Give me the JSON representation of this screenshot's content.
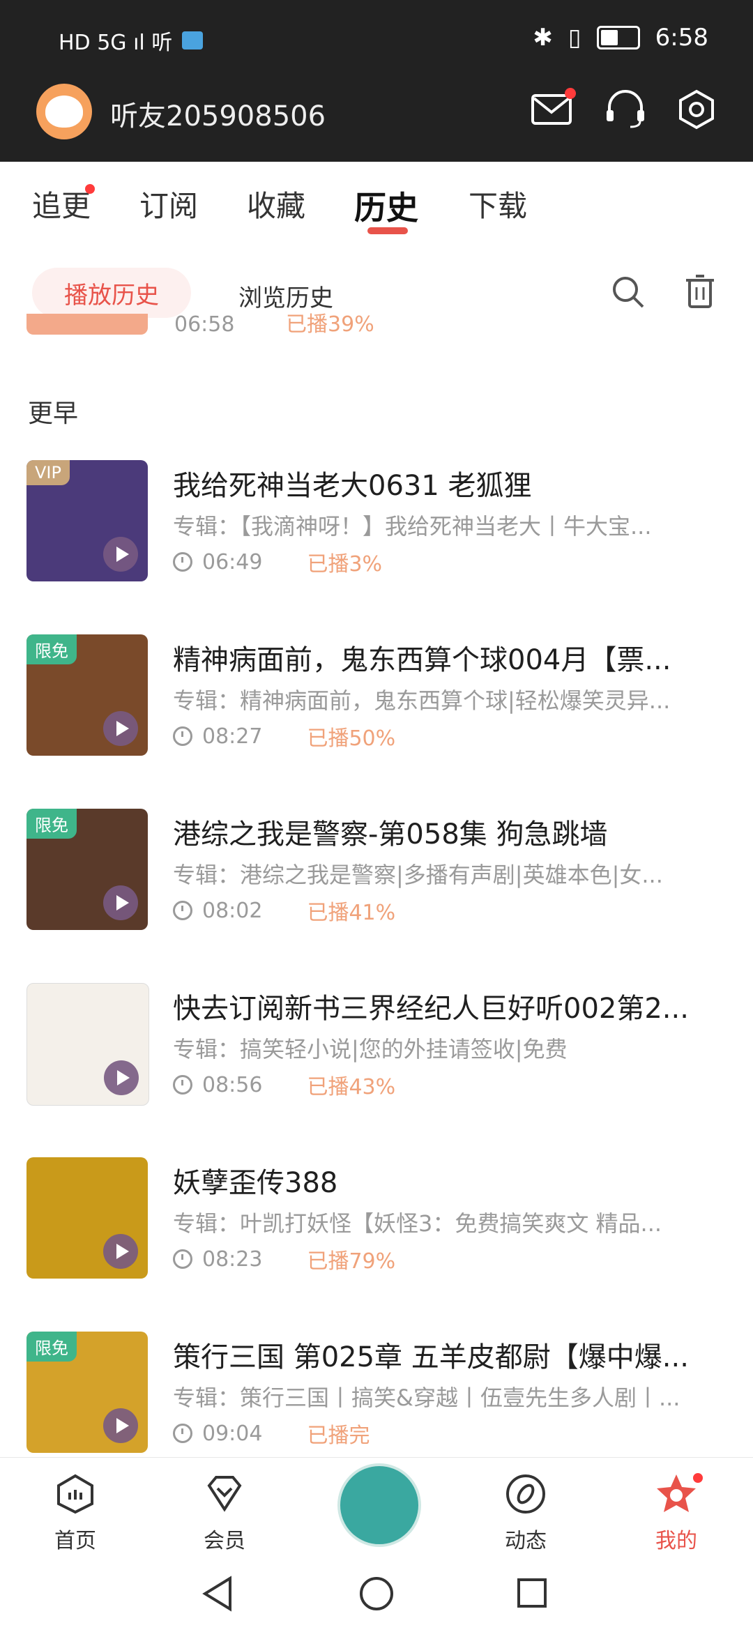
{
  "status_bar": {
    "left_text": "HD 5G ıl 听",
    "time": "6:58",
    "battery_percent": 55
  },
  "profile": {
    "username": "听友205908506"
  },
  "tabs": [
    {
      "label": "追更",
      "has_dot": true
    },
    {
      "label": "订阅"
    },
    {
      "label": "收藏"
    },
    {
      "label": "历史",
      "active": true
    },
    {
      "label": "下载"
    }
  ],
  "subtabs": {
    "active": "播放历史",
    "other": "浏览历史"
  },
  "partial_row": {
    "time": "06:58",
    "progress": "已播39%"
  },
  "section_label": "更早",
  "items": [
    {
      "title": "我给死神当老大0631 老狐狸",
      "album": "专辑：【我滴神呀！】我给死神当老大丨牛大宝...",
      "time": "06:49",
      "progress": "已播3%",
      "badge": "VIP",
      "badge_color": "#c8a57a",
      "cover_color": "#4b3a7a"
    },
    {
      "title": "精神病面前，鬼东西算个球004月【票...",
      "album": "专辑：精神病面前，鬼东西算个球|轻松爆笑灵异...",
      "time": "08:27",
      "progress": "已播50%",
      "badge": "限免",
      "badge_color": "#3fb58a",
      "cover_color": "#7a4a2a"
    },
    {
      "title": "港综之我是警察-第058集 狗急跳墙",
      "album": "专辑：港综之我是警察|多播有声剧|英雄本色|女...",
      "time": "08:02",
      "progress": "已播41%",
      "badge": "限免",
      "badge_color": "#3fb58a",
      "cover_color": "#5a3a2a"
    },
    {
      "title": "快去订阅新书三界经纪人巨好听002第2...",
      "album": "专辑：搞笑轻小说|您的外挂请签收|免费",
      "time": "08:56",
      "progress": "已播43%",
      "badge": "",
      "badge_color": "",
      "cover_color": "#f4f0ea"
    },
    {
      "title": "妖孽歪传388",
      "album": "专辑：叶凯打妖怪【妖怪3：免费搞笑爽文 精品...",
      "time": "08:23",
      "progress": "已播79%",
      "badge": "",
      "badge_color": "",
      "cover_color": "#c99a1a"
    },
    {
      "title": "策行三国 第025章 五羊皮都尉【爆中爆...",
      "album": "专辑：策行三国丨搞笑&穿越丨伍壹先生多人剧丨...",
      "time": "09:04",
      "progress": "已播完",
      "badge": "限免",
      "badge_color": "#3fb58a",
      "cover_color": "#d4a22a"
    }
  ],
  "bottom_nav": [
    {
      "label": "首页",
      "icon": "home-icon"
    },
    {
      "label": "会员",
      "icon": "vip-diamond-icon"
    },
    {
      "label": "动态",
      "icon": "activity-icon"
    },
    {
      "label": "我的",
      "icon": "mine-star-icon",
      "active": true
    }
  ],
  "colors": {
    "accent": "#e8534a",
    "progress": "#f0a27a",
    "header_bg": "#222222"
  }
}
